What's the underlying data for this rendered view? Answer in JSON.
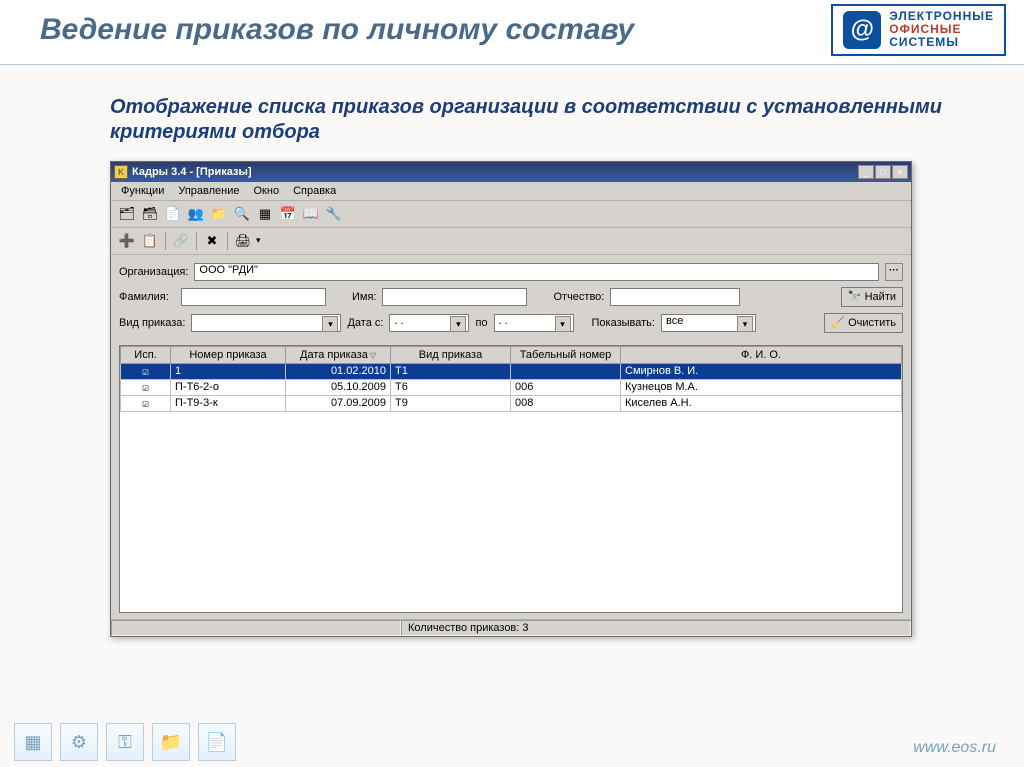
{
  "slide": {
    "title": "Ведение приказов по личному составу",
    "subtitle": "Отображение списка приказов организации в соответствии с установленными критериями отбора"
  },
  "logo": {
    "line1": "ЭЛЕКТРОННЫЕ",
    "line2a": "ОФИСНЫЕ",
    "line3": "СИСТЕМЫ"
  },
  "footer": {
    "url": "www.eos.ru"
  },
  "app": {
    "title": "Кадры 3.4 - [Приказы]",
    "menu": [
      "Функции",
      "Управление",
      "Окно",
      "Справка"
    ],
    "form": {
      "org_label": "Организация:",
      "org_value": "ООО \"РДИ\"",
      "last_label": "Фамилия:",
      "first_label": "Имя:",
      "middle_label": "Отчество:",
      "find_btn": "Найти",
      "type_label": "Вид приказа:",
      "date_from_label": "Дата с:",
      "date_to_label": "по",
      "date_placeholder": ".  .",
      "show_label": "Показывать:",
      "show_value": "все",
      "clear_btn": "Очистить"
    },
    "columns": {
      "c0": "Исп.",
      "c1": "Номер приказа",
      "c2": "Дата приказа",
      "c3": "Вид приказа",
      "c4": "Табельный номер",
      "c5": "Ф. И. О."
    },
    "rows": [
      {
        "num": "1",
        "date": "01.02.2010",
        "type": "Т1",
        "tab": "",
        "fio": "Смирнов В. И."
      },
      {
        "num": "П-Т6-2-о",
        "date": "05.10.2009",
        "type": "Т6",
        "tab": "006",
        "fio": "Кузнецов М.А."
      },
      {
        "num": "П-Т9-3-к",
        "date": "07.09.2009",
        "type": "Т9",
        "tab": "008",
        "fio": "Киселев А.Н."
      }
    ],
    "status": "Количество приказов: 3"
  }
}
